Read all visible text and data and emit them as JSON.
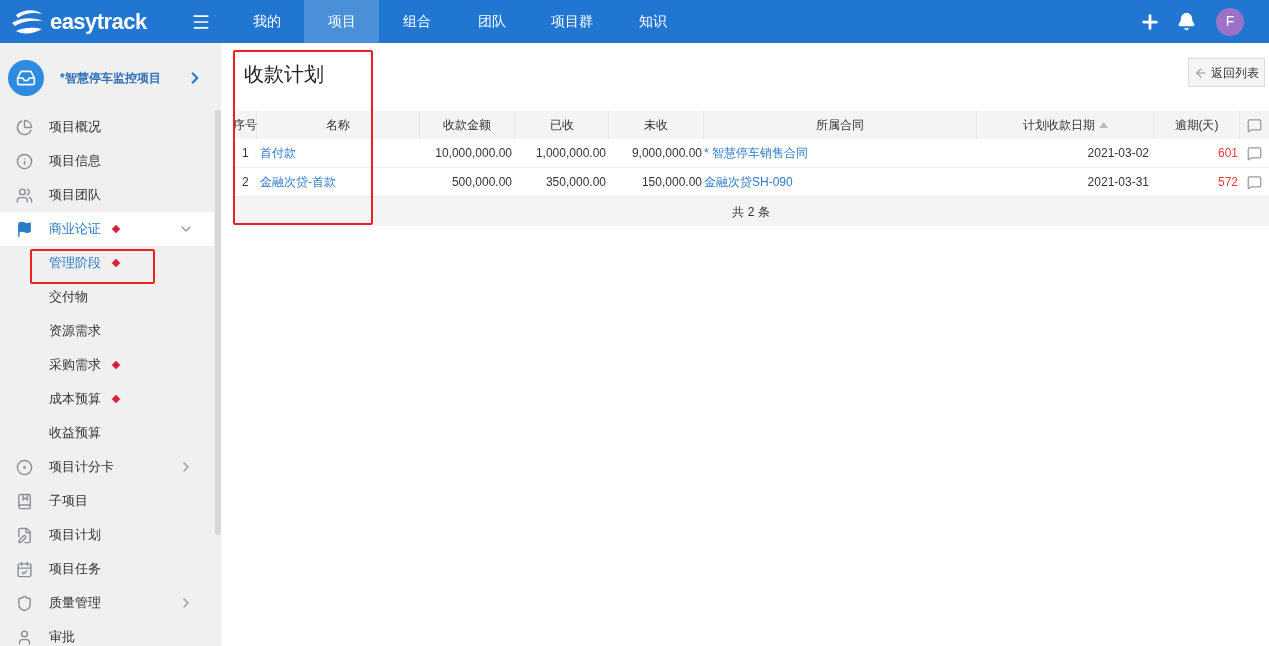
{
  "topbar": {
    "logo": "easytrack",
    "nav": [
      {
        "label": "我的",
        "selected": false
      },
      {
        "label": "项目",
        "selected": true
      },
      {
        "label": "组合",
        "selected": false
      },
      {
        "label": "团队",
        "selected": false
      },
      {
        "label": "项目群",
        "selected": false
      },
      {
        "label": "知识",
        "selected": false
      }
    ],
    "avatar": "F"
  },
  "sidebar": {
    "project": "*智慧停车监控项目",
    "items": [
      {
        "label": "项目概况",
        "selected": false,
        "marked": false
      },
      {
        "label": "项目信息",
        "selected": false,
        "marked": false
      },
      {
        "label": "项目团队",
        "selected": false,
        "marked": false
      },
      {
        "label": "商业论证",
        "selected": true,
        "marked": true,
        "expanded": true,
        "children": [
          {
            "label": "管理阶段",
            "selected": true,
            "marked": true
          },
          {
            "label": "交付物",
            "selected": false,
            "marked": false
          },
          {
            "label": "资源需求",
            "selected": false,
            "marked": false
          },
          {
            "label": "采购需求",
            "selected": false,
            "marked": true
          },
          {
            "label": "成本预算",
            "selected": false,
            "marked": true
          },
          {
            "label": "收益预算",
            "selected": false,
            "marked": false
          }
        ]
      },
      {
        "label": "项目计分卡",
        "selected": false,
        "marked": false,
        "expanded": false
      },
      {
        "label": "子项目",
        "selected": false,
        "marked": false
      },
      {
        "label": "项目计划",
        "selected": false,
        "marked": false
      },
      {
        "label": "项目任务",
        "selected": false,
        "marked": false
      },
      {
        "label": "质量管理",
        "selected": false,
        "marked": false,
        "expanded": false
      },
      {
        "label": "审批",
        "selected": false,
        "marked": false
      }
    ]
  },
  "page": {
    "title": "收款计划",
    "back_button": "返回列表",
    "table": {
      "columns": [
        "序号",
        "名称",
        "收款金额",
        "已收",
        "未收",
        "所属合同",
        "计划收款日期",
        "逾期(天)"
      ],
      "rows": [
        {
          "no": "1",
          "name": "首付款",
          "amount": "10,000,000.00",
          "received": "1,000,000.00",
          "outstanding": "9,000,000.00",
          "contract": "* 智慧停车销售合同",
          "date": "2021-03-02",
          "overdue": "601"
        },
        {
          "no": "2",
          "name": "金融次贷-首款",
          "amount": "500,000.00",
          "received": "350,000.00",
          "outstanding": "150,000.00",
          "contract": "金融次贷SH-090",
          "date": "2021-03-31",
          "overdue": "572"
        }
      ],
      "footer": "共 2 条"
    }
  }
}
